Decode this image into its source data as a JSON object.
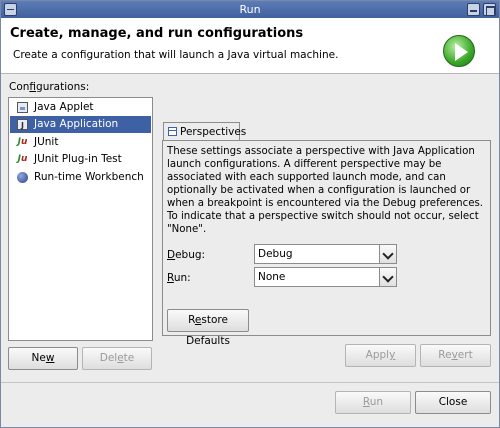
{
  "window": {
    "title": "Run"
  },
  "header": {
    "title": "Create, manage, and run configurations",
    "description": "Create a configuration that will launch a Java virtual machine."
  },
  "configurations": {
    "label_pre": "Con",
    "label_u": "f",
    "label_post": "igurations:",
    "items": [
      {
        "label": "Java Applet",
        "icon": "java-applet-icon"
      },
      {
        "label": "Java Application",
        "icon": "java-application-icon",
        "selected": true
      },
      {
        "label": "JUnit",
        "icon": "junit-icon"
      },
      {
        "label": "JUnit Plug-in Test",
        "icon": "junit-plugin-icon"
      },
      {
        "label": "Run-time Workbench",
        "icon": "workbench-icon"
      }
    ]
  },
  "left_buttons": {
    "new_pre": "Ne",
    "new_u": "w",
    "new_post": "",
    "delete_pre": "Del",
    "delete_u": "e",
    "delete_post": "te"
  },
  "perspectives": {
    "tab_label": "Perspectives",
    "description": "These settings associate a perspective with Java Application launch configurations. A different perspective may be associated with each supported launch mode, and can optionally be activated when a configuration is launched or when a breakpoint is encountered via the Debug preferences. To indicate that a perspective switch should not occur, select \"None\".",
    "debug_label_u": "D",
    "debug_label_post": "ebug:",
    "debug_value": "Debug",
    "run_label_u": "R",
    "run_label_post": "un:",
    "run_value": "None",
    "restore_pre": "R",
    "restore_u": "e",
    "restore_post": "store Defaults"
  },
  "panel_buttons": {
    "apply_pre": "Appl",
    "apply_u": "y",
    "apply_post": "",
    "revert_pre": "Re",
    "revert_u": "v",
    "revert_post": "ert"
  },
  "bottom_buttons": {
    "run_pre": "",
    "run_u": "R",
    "run_post": "un",
    "close": "Close"
  }
}
